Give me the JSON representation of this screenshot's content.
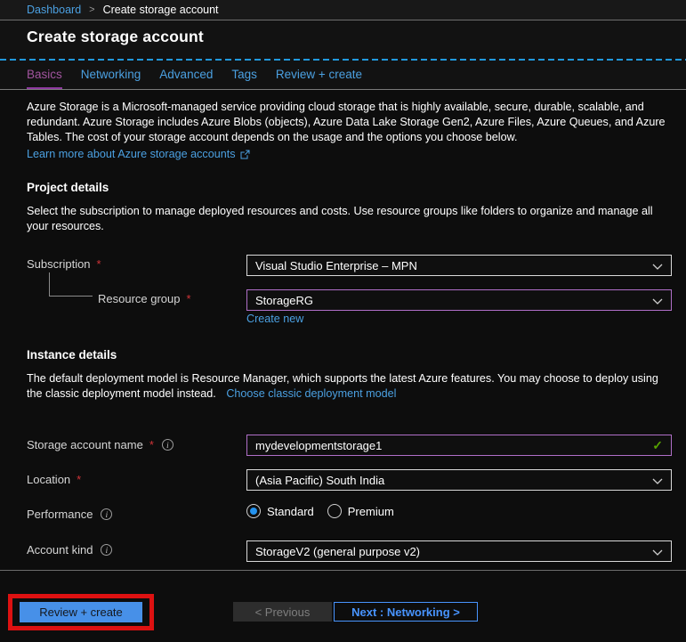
{
  "breadcrumb": {
    "dashboard": "Dashboard",
    "separator": ">",
    "current": "Create storage account"
  },
  "page": {
    "title": "Create storage account"
  },
  "tabs": [
    {
      "label": "Basics",
      "active": true
    },
    {
      "label": "Networking",
      "active": false
    },
    {
      "label": "Advanced",
      "active": false
    },
    {
      "label": "Tags",
      "active": false
    },
    {
      "label": "Review + create",
      "active": false
    }
  ],
  "intro": {
    "text": "Azure Storage is a Microsoft-managed service providing cloud storage that is highly available, secure, durable, scalable, and redundant. Azure Storage includes Azure Blobs (objects), Azure Data Lake Storage Gen2, Azure Files, Azure Queues, and Azure Tables. The cost of your storage account depends on the usage and the options you choose below.",
    "learn_more": "Learn more about Azure storage accounts"
  },
  "sections": {
    "project": {
      "heading": "Project details",
      "description": "Select the subscription to manage deployed resources and costs. Use resource groups like folders to organize and manage all your resources."
    },
    "instance": {
      "heading": "Instance details",
      "description": "The default deployment model is Resource Manager, which supports the latest Azure features. You may choose to deploy using the classic deployment model instead.",
      "link": "Choose classic deployment model"
    }
  },
  "form": {
    "required_marker": "*",
    "subscription": {
      "label": "Subscription",
      "value": "Visual Studio Enterprise – MPN"
    },
    "resource_group": {
      "label": "Resource group",
      "value": "StorageRG",
      "create_new": "Create new"
    },
    "storage_account_name": {
      "label": "Storage account name",
      "value": "mydevelopmentstorage1"
    },
    "location": {
      "label": "Location",
      "value": "(Asia Pacific) South India"
    },
    "performance": {
      "label": "Performance",
      "options": [
        {
          "label": "Standard",
          "selected": true
        },
        {
          "label": "Premium",
          "selected": false
        }
      ]
    },
    "account_kind": {
      "label": "Account kind",
      "value": "StorageV2 (general purpose v2)"
    }
  },
  "footer": {
    "review_create": "Review + create",
    "previous": "< Previous",
    "next": "Next : Networking >"
  },
  "icons": {
    "info": "i",
    "check": "✓"
  },
  "colors": {
    "link_blue": "#4ba0e1",
    "active_tab_purple": "#a1549e",
    "tab_underline_purple": "#8f3aa0",
    "dashed_divider_blue": "#2199dd",
    "focus_border_purple": "#b06fc8",
    "valid_green": "#57a300",
    "required_red": "#d13438",
    "radio_blue": "#2493ef",
    "primary_button_blue": "#4790e8",
    "annotation_red": "#dd1111",
    "background": "#0d0d0d"
  }
}
